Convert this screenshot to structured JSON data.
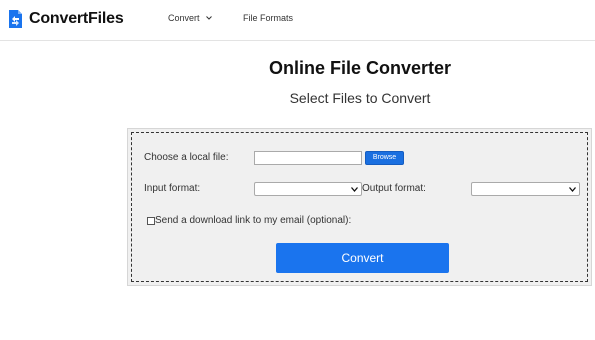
{
  "header": {
    "logo_text": "ConvertFiles",
    "nav": {
      "convert_label": "Convert",
      "formats_label": "File Formats"
    }
  },
  "main": {
    "title": "Online File Converter",
    "subtitle": "Select Files to Convert"
  },
  "form": {
    "choose_file_label": "Choose a local file:",
    "browse_label": "Browse",
    "input_format_label": "Input format:",
    "output_format_label": "Output format:",
    "email_checkbox_label": "Send a download link to my email (optional):",
    "convert_label": "Convert",
    "input_format_value": "",
    "output_format_value": ""
  },
  "colors": {
    "accent": "#1a74ee",
    "browse": "#1a6fe0"
  }
}
